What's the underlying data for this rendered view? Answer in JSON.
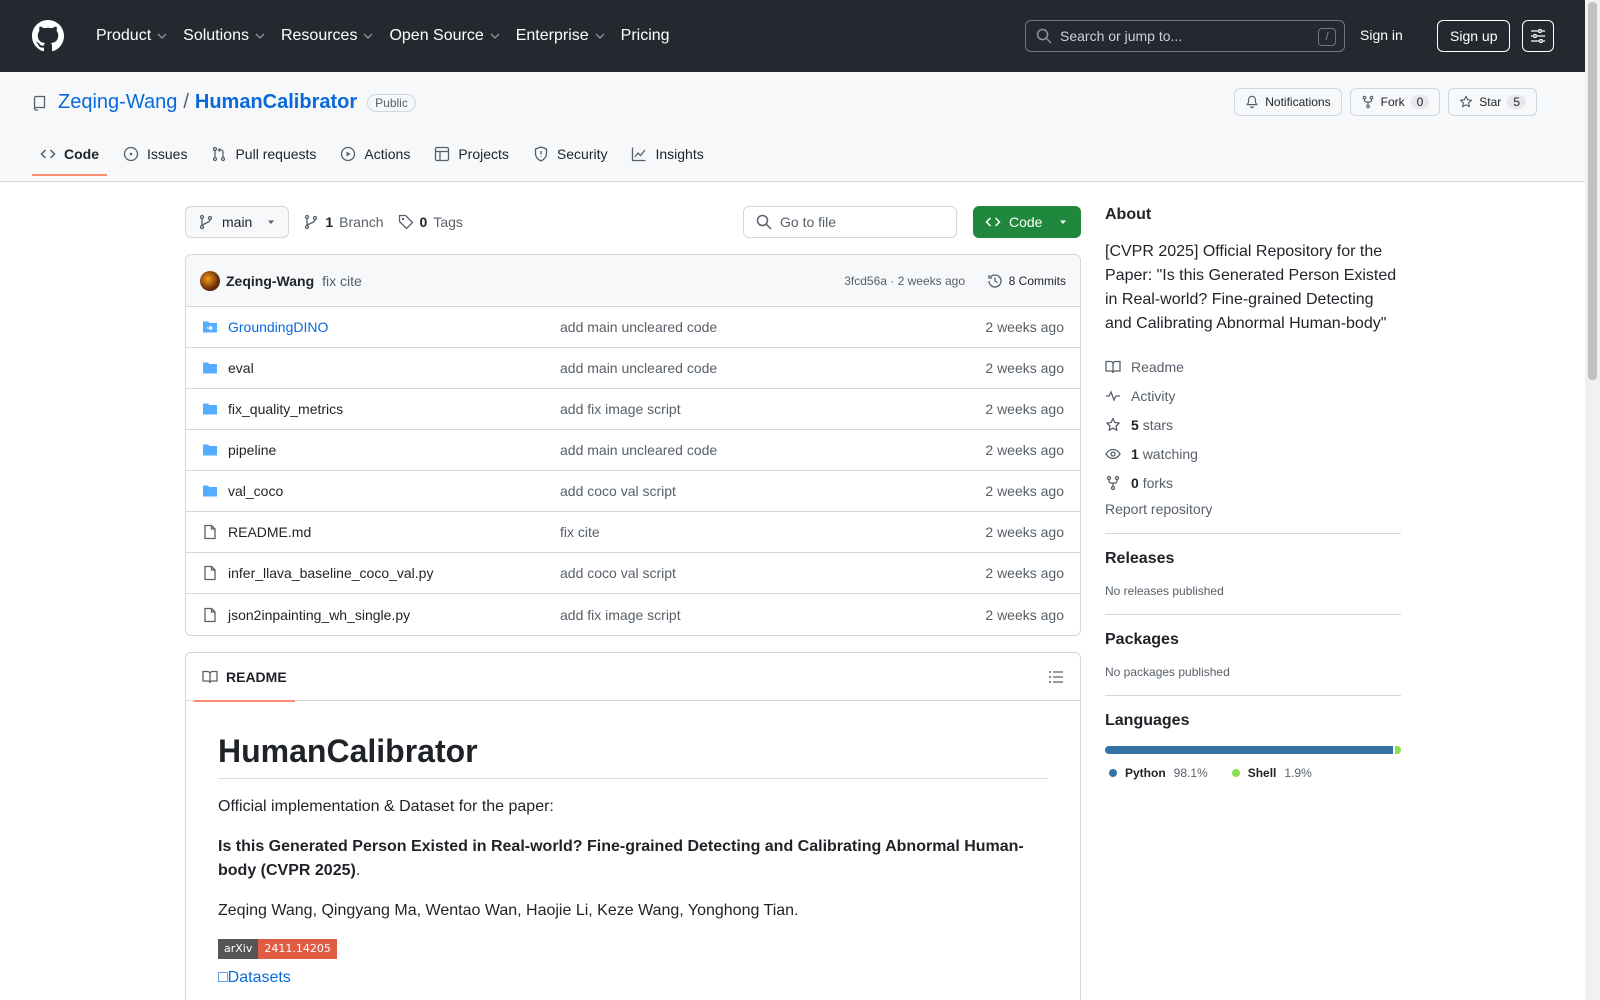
{
  "header": {
    "nav": [
      "Product",
      "Solutions",
      "Resources",
      "Open Source",
      "Enterprise",
      "Pricing"
    ],
    "search_placeholder": "Search or jump to...",
    "search_shortcut": "/",
    "signin": "Sign in",
    "signup": "Sign up"
  },
  "repo": {
    "owner": "Zeqing-Wang",
    "separator": "/",
    "name": "HumanCalibrator",
    "visibility": "Public",
    "notifications": "Notifications",
    "fork_label": "Fork",
    "fork_count": "0",
    "star_label": "Star",
    "star_count": "5",
    "tabs": [
      "Code",
      "Issues",
      "Pull requests",
      "Actions",
      "Projects",
      "Security",
      "Insights"
    ]
  },
  "toolbar": {
    "branch": "main",
    "branch_count": "1",
    "branch_label": "Branch",
    "tag_count": "0",
    "tag_label": "Tags",
    "goto_placeholder": "Go to file",
    "code_button": "Code"
  },
  "commit": {
    "author": "Zeqing-Wang",
    "message": "fix cite",
    "meta": "3fcd56a · 2 weeks ago",
    "count": "8 Commits"
  },
  "files": [
    {
      "name": "GroundingDINO",
      "type": "submodule",
      "message": "add main uncleared code",
      "time": "2 weeks ago"
    },
    {
      "name": "eval",
      "type": "folder",
      "message": "add main uncleared code",
      "time": "2 weeks ago"
    },
    {
      "name": "fix_quality_metrics",
      "type": "folder",
      "message": "add fix image script",
      "time": "2 weeks ago"
    },
    {
      "name": "pipeline",
      "type": "folder",
      "message": "add main uncleared code",
      "time": "2 weeks ago"
    },
    {
      "name": "val_coco",
      "type": "folder",
      "message": "add coco val script",
      "time": "2 weeks ago"
    },
    {
      "name": "README.md",
      "type": "file",
      "message": "fix cite",
      "time": "2 weeks ago"
    },
    {
      "name": "infer_llava_baseline_coco_val.py",
      "type": "file",
      "message": "add coco val script",
      "time": "2 weeks ago"
    },
    {
      "name": "json2inpainting_wh_single.py",
      "type": "file",
      "message": "add fix image script",
      "time": "2 weeks ago"
    }
  ],
  "readme": {
    "tab": "README",
    "title": "HumanCalibrator",
    "intro": "Official implementation & Dataset for the paper:",
    "paper_title": "Is this Generated Person Existed in Real-world? Fine-grained Detecting and Calibrating Abnormal Human-body (CVPR 2025)",
    "paper_tail": ".",
    "authors": "Zeqing Wang, Qingyang Ma, Wentao Wan, Haojie Li, Keze Wang, Yonghong Tian.",
    "badge_left": "arXiv",
    "badge_right": "2411.14205",
    "datasets_link": "□Datasets"
  },
  "sidebar": {
    "about_title": "About",
    "description": "[CVPR 2025] Official Repository for the Paper: \"Is this Generated Person Existed in Real-world? Fine-grained Detecting and Calibrating Abnormal Human-body\"",
    "readme": "Readme",
    "activity": "Activity",
    "stars_count": "5",
    "stars_label": "stars",
    "watching_count": "1",
    "watching_label": "watching",
    "forks_count": "0",
    "forks_label": "forks",
    "report": "Report repository",
    "releases_title": "Releases",
    "releases_note": "No releases published",
    "packages_title": "Packages",
    "packages_note": "No packages published",
    "languages_title": "Languages",
    "languages": [
      {
        "name": "Python",
        "pct": "98.1%",
        "value": 98.1,
        "color": "#3572A5"
      },
      {
        "name": "Shell",
        "pct": "1.9%",
        "value": 1.9,
        "color": "#89e051"
      }
    ]
  }
}
